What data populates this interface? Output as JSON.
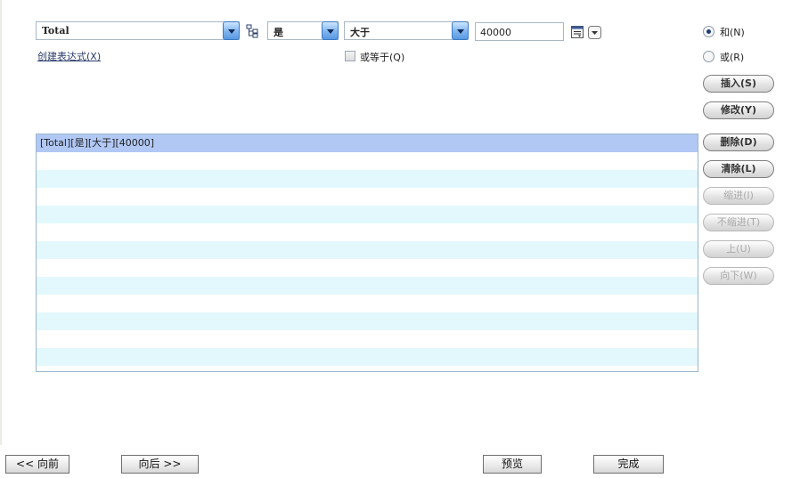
{
  "filter": {
    "field": "Total",
    "condition": "是",
    "operator": "大于",
    "value": "40000",
    "create_expression": "创建表达式(X)",
    "or_equal_label": "或等于(Q)"
  },
  "logic": {
    "and_label": "和(N)",
    "or_label": "或(R)"
  },
  "actions": {
    "insert": "插入(S)",
    "modify": "修改(Y)",
    "delete": "删除(D)",
    "clear": "清除(L)",
    "indent": "缩进(I)",
    "outdent": "不缩进(T)",
    "up": "上(U)",
    "down": "向下(W)"
  },
  "list": {
    "rows": [
      "[Total][是][大于][40000]",
      "",
      "",
      "",
      "",
      "",
      "",
      "",
      "",
      "",
      "",
      "",
      ""
    ]
  },
  "nav": {
    "back": "<< 向前",
    "next": "向后 >>",
    "preview": "预览",
    "finish": "完成"
  },
  "colors": {
    "selected_row": "#b1c8f5",
    "alt_row": "#e3f8fc",
    "combo_button": "#7fb4ef"
  }
}
